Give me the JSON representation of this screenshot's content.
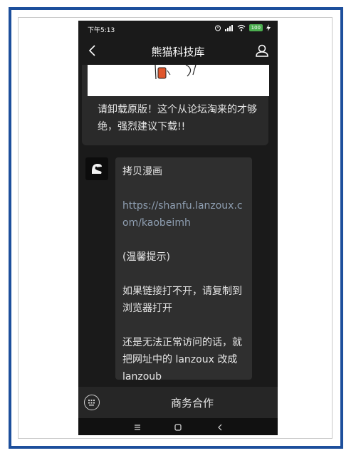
{
  "status_bar": {
    "time": "下午5:13",
    "battery": "100"
  },
  "header": {
    "title": "熊猫科技库",
    "back_icon": "chevron-left-icon",
    "profile_icon": "person-icon"
  },
  "previous_message": {
    "text": "请卸载原版！这个从论坛淘来的才够绝，强烈建议下载!!"
  },
  "message": {
    "title": "拷贝漫画",
    "link": "https://shanfu.lanzoux.com/kaobeimh",
    "tip_label": "(温馨提示)",
    "tip_1": "如果链接打不开，请复制到浏览器打开",
    "tip_2": "还是无法正常访问的话，就把网址中的 lanzoux 改成 lanzoub"
  },
  "bottom_bar": {
    "menu_label": "商务合作",
    "keyboard_icon": "keyboard-icon"
  },
  "nav": {
    "icons": [
      "menu-icon",
      "home-square-icon",
      "back-icon"
    ]
  },
  "colors": {
    "frame": "#1d4f9c",
    "background": "#1a1a1a",
    "bubble": "#2f2f2f",
    "link": "#8f9fb2",
    "battery": "#4caf50"
  }
}
